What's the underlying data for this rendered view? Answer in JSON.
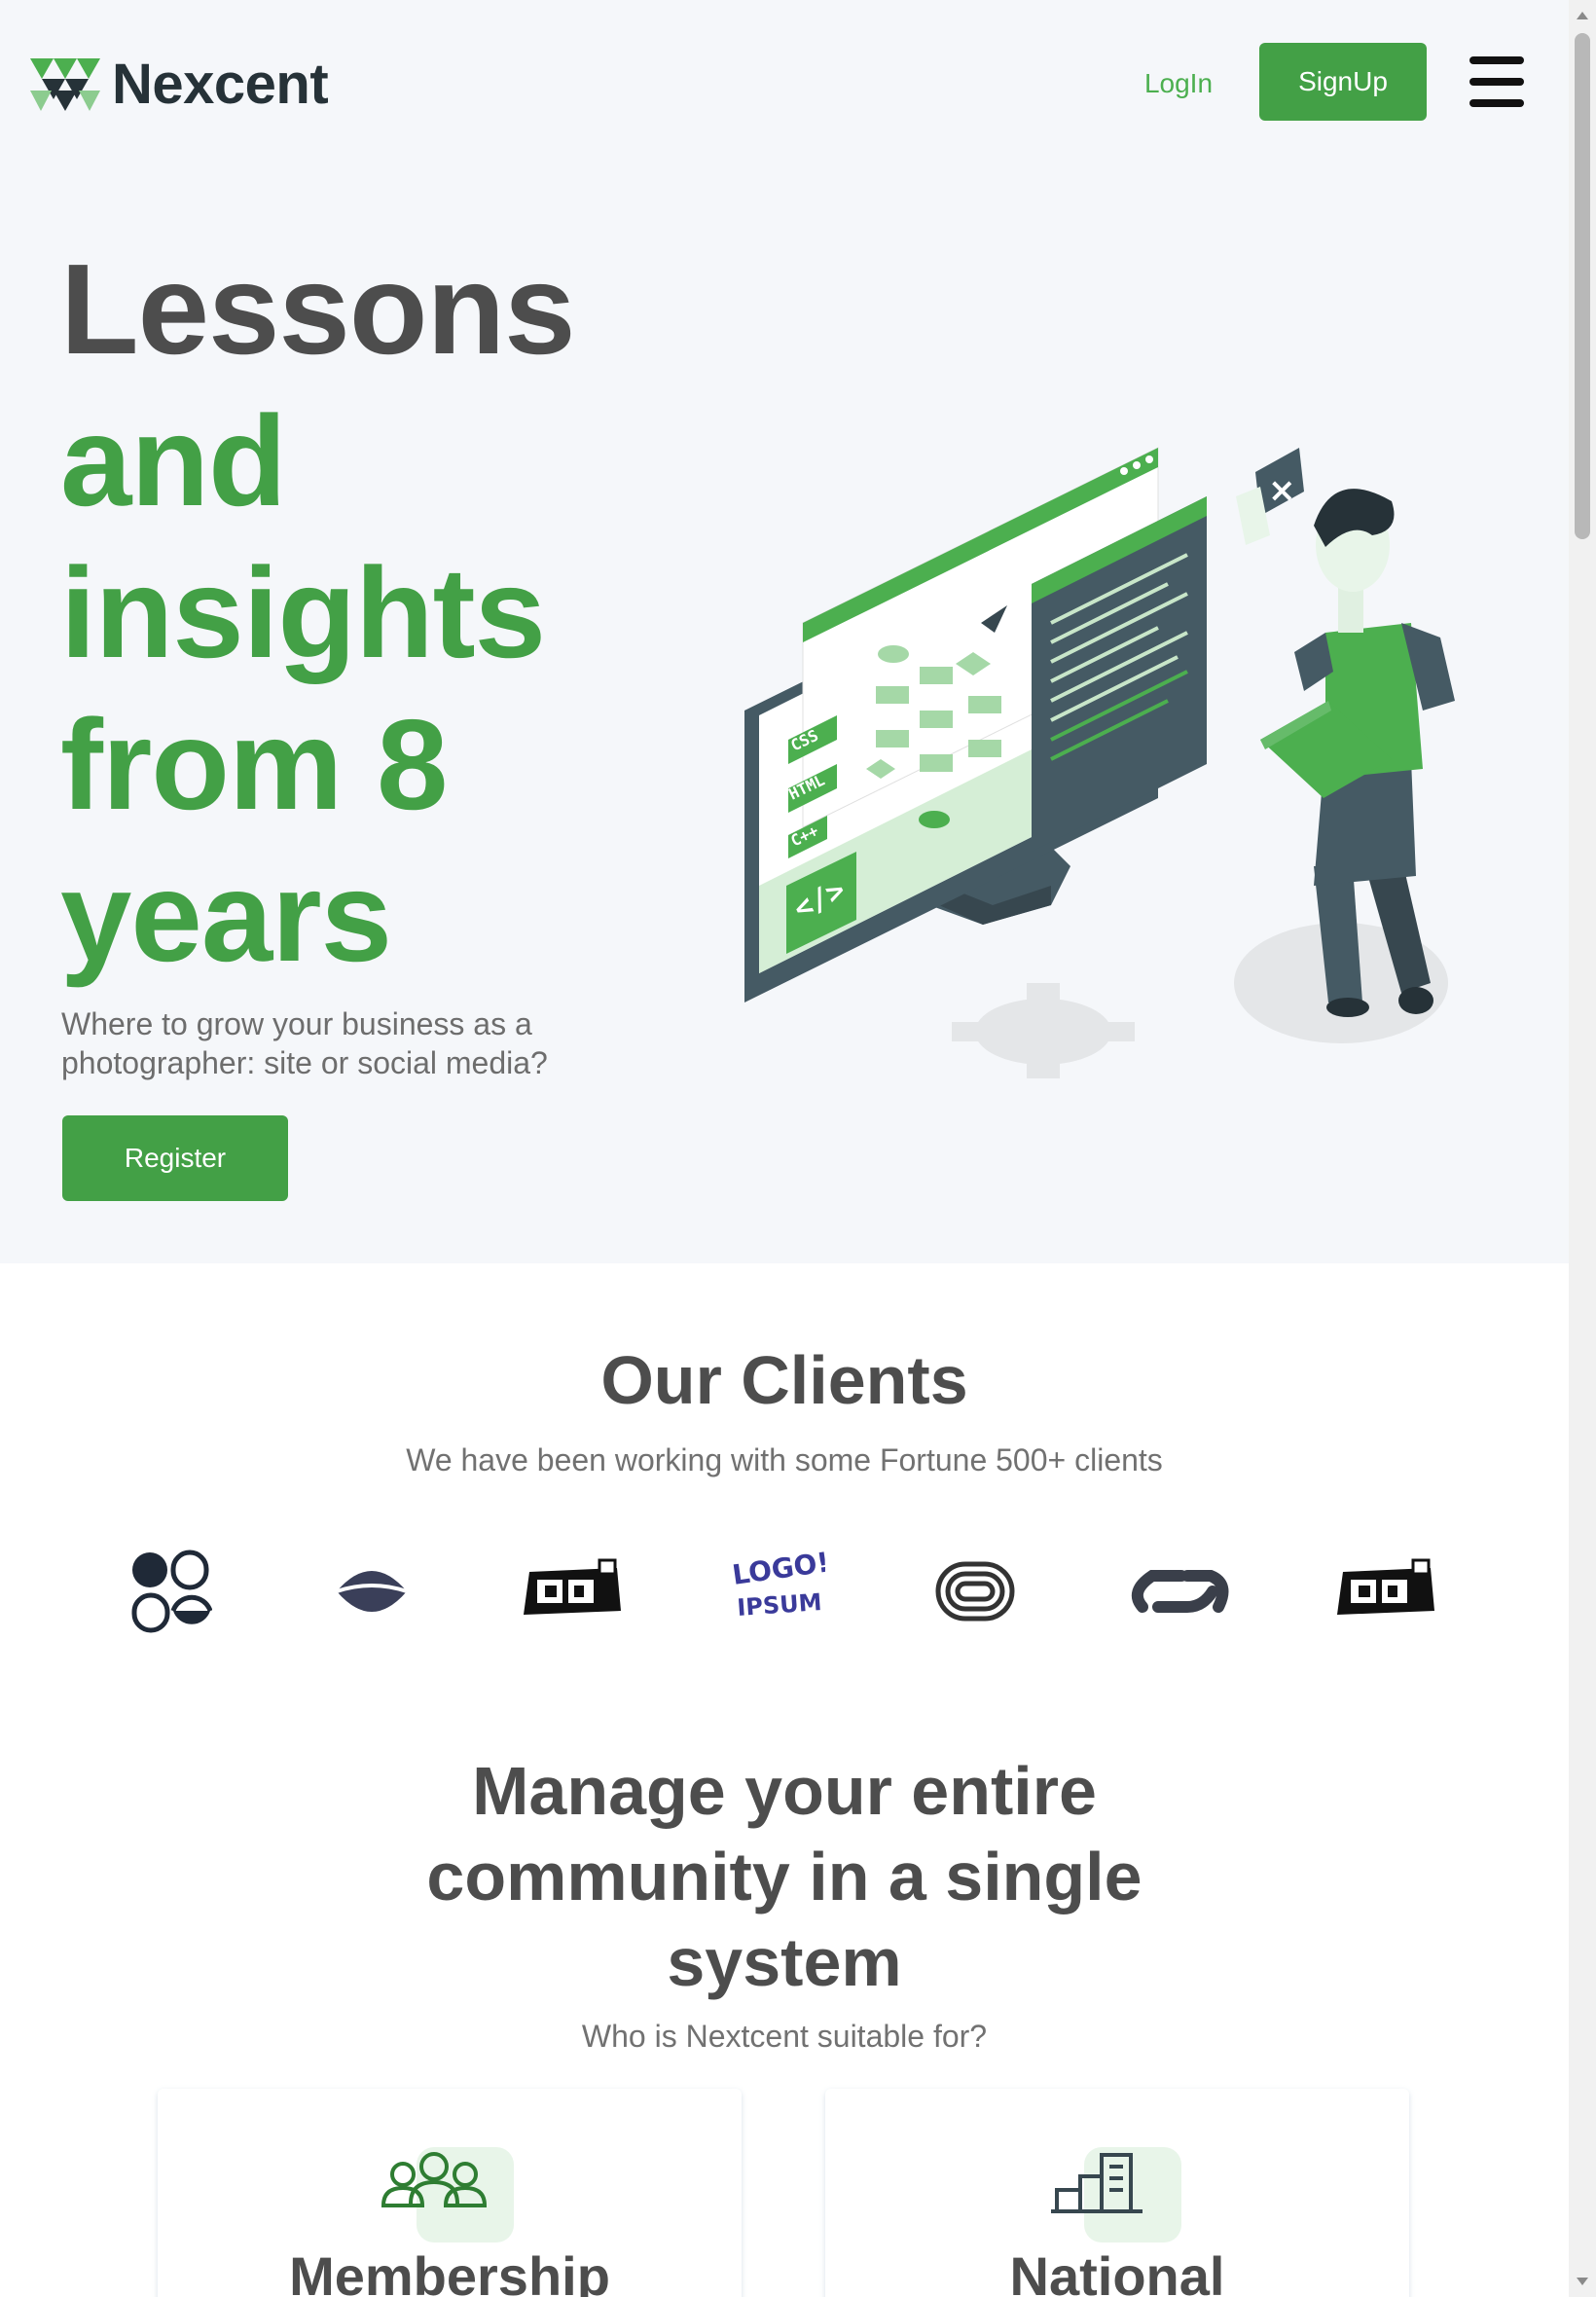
{
  "brand": {
    "name": "Nexcent"
  },
  "nav": {
    "login": "LogIn",
    "signup": "SignUp",
    "menu_icon": "hamburger-menu-icon"
  },
  "hero": {
    "title_dark": "Lessons",
    "title_green_1": "and",
    "title_green_2": "insights",
    "title_green_3": "from 8",
    "title_green_4": "years",
    "subtitle": "Where to grow your business as a photographer: site or social media?",
    "cta": "Register",
    "illustration_code_tags": [
      "CSS",
      "HTML",
      "C++"
    ]
  },
  "clients": {
    "title": "Our Clients",
    "subtitle": "We have been working with some Fortune 500+ clients",
    "logo_wordmark": "LOGO! IPSUM"
  },
  "community": {
    "title": "Manage your entire community in a single system",
    "subtitle": "Who is Nextcent suitable for?",
    "cards": [
      {
        "title": "Membership",
        "icon": "people-group-icon"
      },
      {
        "title": "National",
        "icon": "buildings-icon"
      }
    ]
  },
  "colors": {
    "primary": "#43a046",
    "dark": "#4d4d4d",
    "heading": "#263238",
    "bg": "#f5f7fa"
  }
}
